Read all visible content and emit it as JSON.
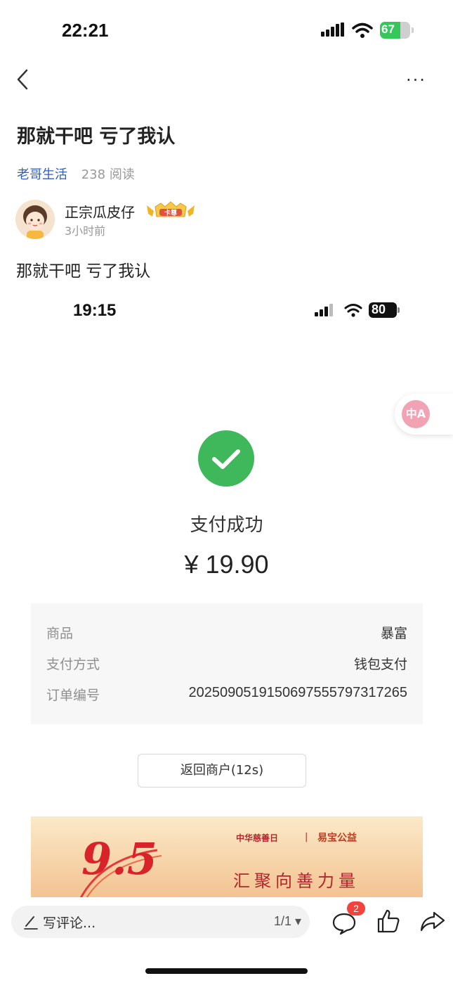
{
  "status_bar": {
    "time": "22:21",
    "battery": "67"
  },
  "nav": {
    "more_label": "···"
  },
  "post": {
    "title": "那就干吧 亏了我认",
    "circle_name": "老哥生活",
    "read_count": "238 阅读",
    "author_name": "正宗瓜皮仔",
    "author_badge": "卡尊",
    "time_ago": "3小时前",
    "body_text": "那就干吧 亏了我认"
  },
  "embedded_screenshot": {
    "status_time": "19:15",
    "battery": "80",
    "translate_label": "中A",
    "payment_status": "支付成功",
    "amount": "¥ 19.90",
    "details": [
      {
        "label": "商品",
        "value": "暴富"
      },
      {
        "label": "支付方式",
        "value": "钱包支付"
      },
      {
        "label": "订单编号",
        "value": "2025090519150697555797317265"
      }
    ],
    "return_button": "返回商户(12s)",
    "banner": {
      "big_number": "9.5",
      "org1": "中华慈善日",
      "separator": "|",
      "org2": "易宝公益",
      "slogan": "汇聚向善力量"
    }
  },
  "bottom_bar": {
    "comment_placeholder": "写评论...",
    "page_indicator": "1/1 ▾",
    "comment_count": "2"
  },
  "colors": {
    "link_blue": "#2f5fbf",
    "success_green": "#3fb75b",
    "battery_green": "#34c759",
    "badge_red": "#f0443d"
  }
}
